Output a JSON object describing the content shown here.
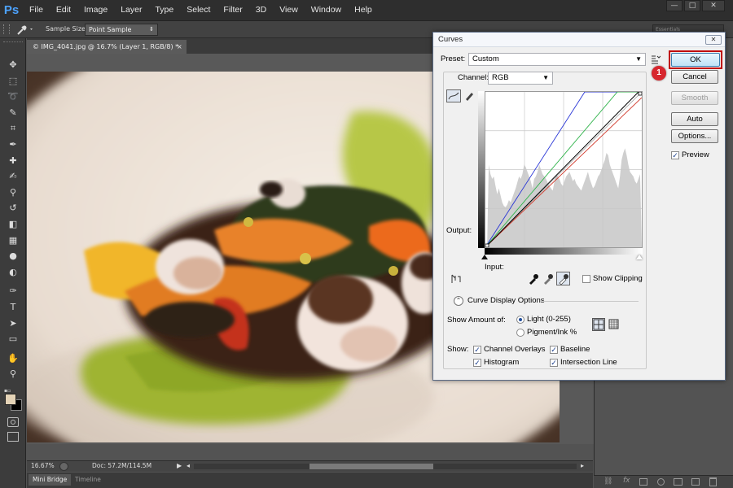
{
  "app": {
    "logo": "Ps",
    "name": "Photoshop"
  },
  "menu": [
    "File",
    "Edit",
    "Image",
    "Layer",
    "Type",
    "Select",
    "Filter",
    "3D",
    "View",
    "Window",
    "Help"
  ],
  "window_controls": {
    "minimize": "—",
    "restore": "□",
    "close": "✕"
  },
  "options_bar": {
    "sample_size_label": "Sample Size:",
    "sample_size_value": "Point Sample",
    "workspace": "Essentials"
  },
  "document": {
    "tab_title": "© IMG_4041.jpg @ 16.7% (Layer 1, RGB/8) *",
    "tab_close": "×",
    "zoom": "16.67%",
    "doc_info": "Doc: 57.2M/114.5M",
    "bottom_tabs": [
      "Mini Bridge",
      "Timeline"
    ]
  },
  "tools": [
    "move-icon",
    "marquee-icon",
    "lasso-icon",
    "quick-select-icon",
    "crop-icon",
    "eyedropper-icon",
    "healing-icon",
    "brush-icon",
    "clone-stamp-icon",
    "history-brush-icon",
    "eraser-icon",
    "gradient-icon",
    "blur-icon",
    "dodge-icon",
    "pen-icon",
    "type-icon",
    "path-select-icon",
    "shape-icon",
    "hand-icon",
    "zoom-icon"
  ],
  "curves": {
    "title": "Curves",
    "close": "✕",
    "preset_label": "Preset:",
    "preset_value": "Custom",
    "channel_label": "Channel:",
    "channel_value": "RGB",
    "output_label": "Output:",
    "input_label": "Input:",
    "show_clipping": "Show Clipping",
    "curve_display_options": "Curve Display Options",
    "show_amount_of": "Show Amount of:",
    "amount_options": [
      {
        "label": "Light  (0-255)",
        "selected": true
      },
      {
        "label": "Pigment/Ink %",
        "selected": false
      }
    ],
    "show_label": "Show:",
    "show_options": [
      {
        "label": "Channel Overlays",
        "checked": true
      },
      {
        "label": "Baseline",
        "checked": true
      },
      {
        "label": "Histogram",
        "checked": true
      },
      {
        "label": "Intersection Line",
        "checked": true
      }
    ],
    "buttons": {
      "ok": "OK",
      "cancel": "Cancel",
      "smooth": "Smooth",
      "auto": "Auto",
      "options": "Options..."
    },
    "preview_label": "Preview",
    "preview_checked": true,
    "step_badge": "1",
    "colors": {
      "red": "#d0392b",
      "green": "#2fb34a",
      "blue": "#2835d6",
      "composite": "#000000",
      "histogram": "#cfcfcf",
      "highlight": "#c00000"
    }
  }
}
